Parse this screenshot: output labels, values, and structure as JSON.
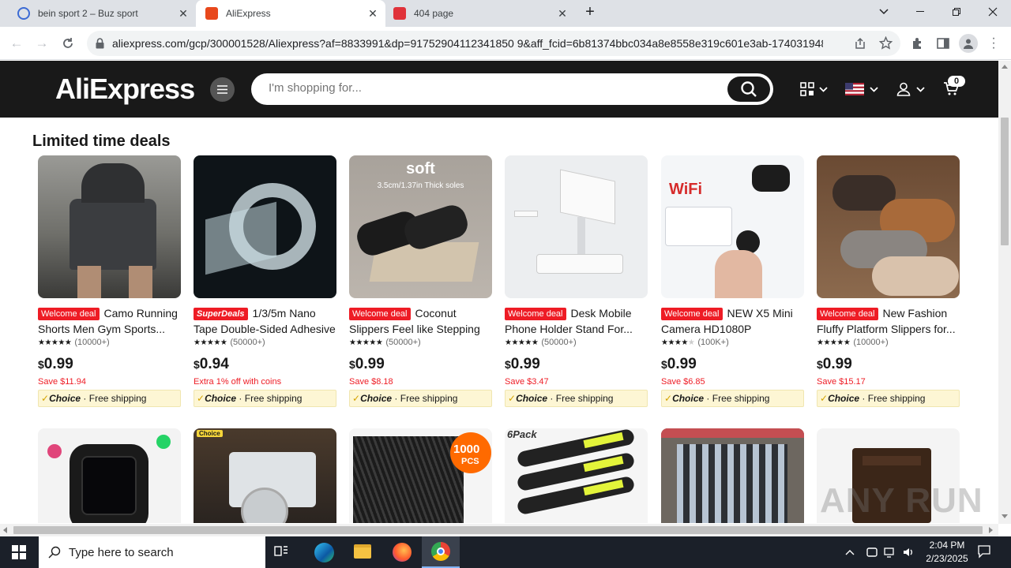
{
  "browser": {
    "tabs": [
      {
        "title": "bein sport 2 – Buz sport",
        "icon": "globe-icon"
      },
      {
        "title": "AliExpress",
        "icon": "aliexpress-icon"
      },
      {
        "title": "404 page",
        "icon": "aliexpress-icon"
      }
    ],
    "new_tab_label": "+",
    "url": "aliexpress.com/gcp/300001528/Aliexpress?af=8833991&dp=91752904112341850 9&aff_fcid=6b81374bbc034a8e8558e319c601e3ab-1740319489..."
  },
  "header": {
    "logo": "AliExpress",
    "search_placeholder": "I'm shopping for...",
    "cart_count": "0"
  },
  "section": {
    "title": "Limited time deals"
  },
  "products": [
    {
      "badge": "Welcome deal",
      "badge_type": "welcome",
      "title": "Camo Running Shorts Men Gym Sports...",
      "rating_count": "(10000+)",
      "price_currency": "$",
      "price": "0.99",
      "save": "Save $11.94",
      "choice": "Choice",
      "shipping": "Free shipping"
    },
    {
      "badge": "SuperDeals",
      "badge_type": "super",
      "title": "1/3/5m Nano Tape Double-Sided Adhesive Tap...",
      "rating_count": "(50000+)",
      "price_currency": "$",
      "price": "0.94",
      "save": "Extra 1% off with coins",
      "choice": "Choice",
      "shipping": "Free shipping"
    },
    {
      "badge": "Welcome deal",
      "badge_type": "welcome",
      "title": "Coconut Slippers Feel like Stepping o...",
      "rating_count": "(50000+)",
      "price_currency": "$",
      "price": "0.99",
      "save": "Save $8.18",
      "choice": "Choice",
      "shipping": "Free shipping"
    },
    {
      "badge": "Welcome deal",
      "badge_type": "welcome",
      "title": "Desk Mobile Phone Holder Stand For...",
      "rating_count": "(50000+)",
      "price_currency": "$",
      "price": "0.99",
      "save": "Save $3.47",
      "choice": "Choice",
      "shipping": "Free shipping"
    },
    {
      "badge": "Welcome deal",
      "badge_type": "welcome",
      "title": "NEW X5 Mini Camera HD1080P Compact...",
      "rating_count": "(100K+)",
      "price_currency": "$",
      "price": "0.99",
      "save": "Save $6.85",
      "choice": "Choice",
      "shipping": "Free shipping"
    },
    {
      "badge": "Welcome deal",
      "badge_type": "welcome",
      "title": "New Fashion Fluffy Platform Slippers for...",
      "rating_count": "(10000+)",
      "price_currency": "$",
      "price": "0.99",
      "save": "Save $15.17",
      "choice": "Choice",
      "shipping": "Free shipping"
    }
  ],
  "image_text": {
    "soft": "soft",
    "thick": "3.5cm/1.37in Thick soles",
    "wifi": "WiFi",
    "pcs_top": "1000",
    "pcs_bottom": "PCS",
    "pack": "6Pack",
    "choice_tag": "Choice"
  },
  "taskbar": {
    "search_placeholder": "Type here to search",
    "time": "2:04 PM",
    "date": "2/23/2025"
  },
  "watermark": "ANY RUN",
  "colors": {
    "accent": "#ee1c25",
    "header_bg": "#191919",
    "choice_bg": "#fdf6d4"
  }
}
